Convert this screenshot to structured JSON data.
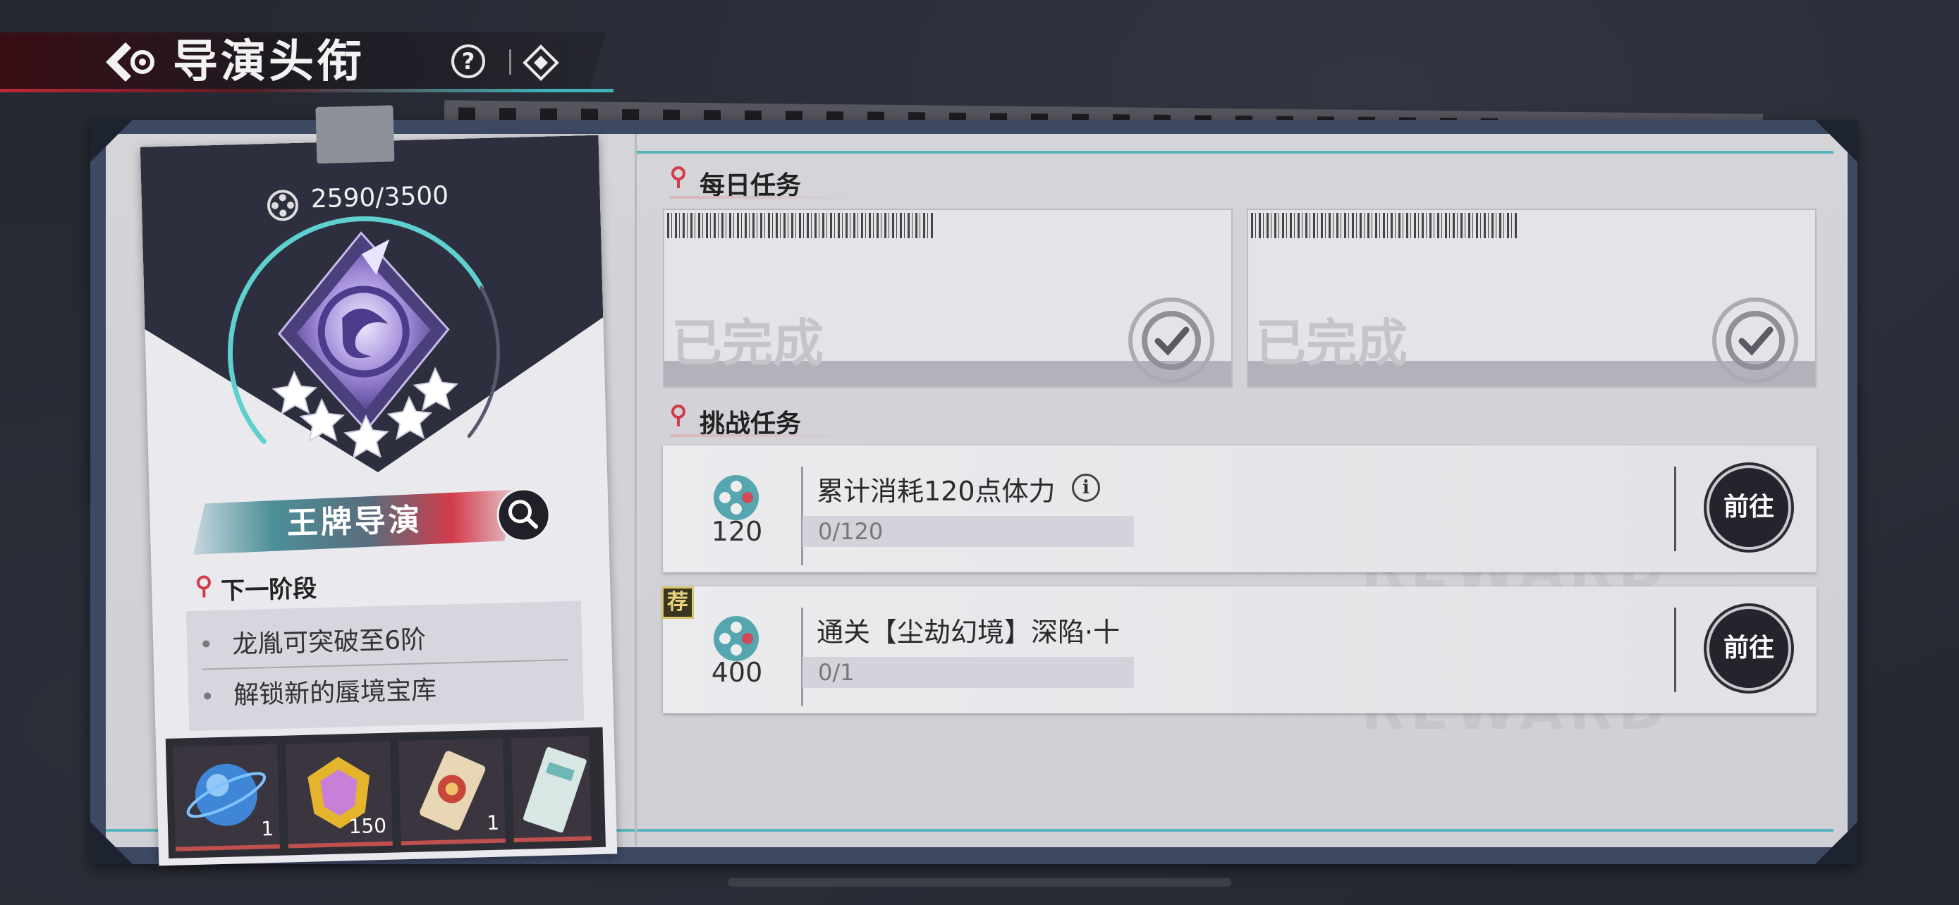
{
  "header": {
    "title": "导演头衔",
    "help_label": "?"
  },
  "card": {
    "progress": "2590/3500",
    "progress_current": 2590,
    "progress_max": 3500,
    "rank_name": "王牌导演",
    "stars": 5,
    "next_stage_title": "下一阶段",
    "next_stage_items": [
      "龙胤可突破至6阶",
      "解锁新的蜃境宝库"
    ],
    "rewards": [
      {
        "icon": "blue-orb-icon",
        "count": "1"
      },
      {
        "icon": "yellow-gem-icon",
        "count": "150"
      },
      {
        "icon": "red-ticket-icon",
        "count": "1"
      },
      {
        "icon": "ticket-icon",
        "count": ""
      }
    ]
  },
  "daily": {
    "title": "每日任务",
    "tasks": [
      {
        "status": "已完成"
      },
      {
        "status": "已完成"
      }
    ]
  },
  "challenge": {
    "title": "挑战任务",
    "tasks": [
      {
        "reward": "120",
        "title": "累计消耗120点体力",
        "progress": "0/120",
        "go_label": "前往",
        "recommended": false
      },
      {
        "reward": "400",
        "title": "通关【尘劫幻境】深陷·十",
        "progress": "0/1",
        "go_label": "前往",
        "recommended": true,
        "badge": "荐"
      }
    ]
  },
  "colors": {
    "accent_red": "#c0283a",
    "accent_teal": "#58b4bc"
  }
}
